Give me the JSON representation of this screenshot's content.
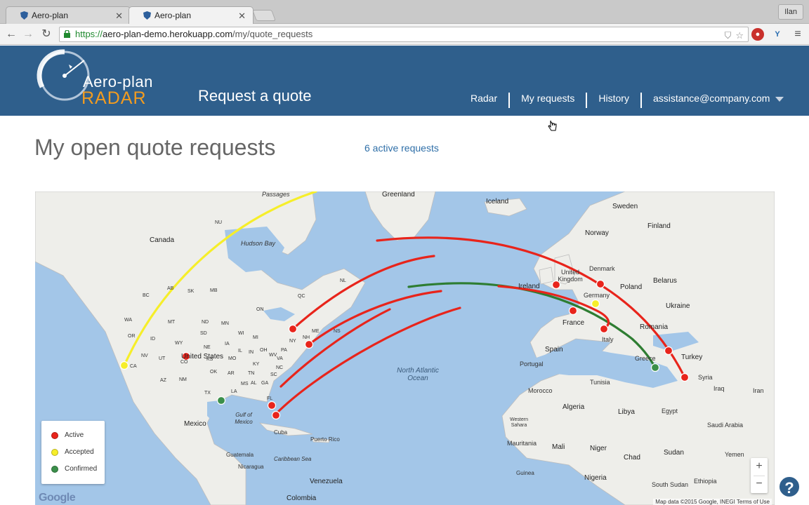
{
  "browser": {
    "tabs": [
      {
        "title": "Aero-plan",
        "active": false
      },
      {
        "title": "Aero-plan",
        "active": true
      }
    ],
    "user": "Ilan",
    "url": {
      "scheme": "https://",
      "host": "aero-plan-demo.herokuapp.com",
      "path": "/my/quote_requests"
    }
  },
  "header": {
    "logo_line1": "Aero-plan",
    "logo_line2": "RADAR",
    "page_title": "Request a quote",
    "nav": [
      {
        "label": "Radar"
      },
      {
        "label": "My requests"
      },
      {
        "label": "History"
      },
      {
        "label": "assistance@company.com"
      }
    ]
  },
  "main": {
    "title": "My open quote requests",
    "active_count": "6 active requests"
  },
  "map": {
    "labels": {
      "passages": "Passages",
      "greenland": "Greenland",
      "iceland": "Iceland",
      "sweden": "Sweden",
      "finland": "Finland",
      "norway": "Norway",
      "canada": "Canada",
      "hudson_bay": "Hudson Bay",
      "uk": "United Kingdom",
      "ireland": "Ireland",
      "denmark": "Denmark",
      "belarus": "Belarus",
      "poland": "Poland",
      "germany": "Germany",
      "ukraine": "Ukraine",
      "france": "France",
      "romania": "Romania",
      "italy": "Italy",
      "spain": "Spain",
      "portugal": "Portugal",
      "greece": "Greece",
      "turkey": "Turkey",
      "syria": "Syria",
      "iraq": "Iraq",
      "iran": "Iran",
      "tunisia": "Tunisia",
      "morocco": "Morocco",
      "algeria": "Algeria",
      "libya": "Libya",
      "egypt": "Egypt",
      "saudi": "Saudi Arabia",
      "western_sahara": "Western Sahara",
      "mauritania": "Mauritania",
      "mali": "Mali",
      "niger": "Niger",
      "chad": "Chad",
      "sudan": "Sudan",
      "south_sudan": "South Sudan",
      "ethiopia": "Ethiopia",
      "yemen": "Yemen",
      "nigeria": "Nigeria",
      "guinea": "Guinea",
      "united_states": "United States",
      "mexico": "Mexico",
      "gulf_of_mexico": "Gulf of Mexico",
      "cuba": "Cuba",
      "puerto_rico": "Puerto Rico",
      "guatemala": "Guatemala",
      "nicaragua": "Nicaragua",
      "caribbean": "Caribbean Sea",
      "venezuela": "Venezuela",
      "colombia": "Colombia",
      "north_atlantic": "North Atlantic Ocean",
      "ca": "CA",
      "nv": "NV",
      "or": "OR",
      "wa": "WA",
      "id": "ID",
      "mt": "MT",
      "wy": "WY",
      "ut": "UT",
      "az": "AZ",
      "co": "CO",
      "nm": "NM",
      "nd": "ND",
      "sd": "SD",
      "ne": "NE",
      "ks": "KS",
      "ok": "OK",
      "tx": "TX",
      "mn": "MN",
      "ia": "IA",
      "mo": "MO",
      "ar": "AR",
      "la": "LA",
      "wi": "WI",
      "il": "IL",
      "mi": "MI",
      "in": "IN",
      "oh": "OH",
      "ky": "KY",
      "tn": "TN",
      "ms": "MS",
      "al": "AL",
      "ga": "GA",
      "fl": "FL",
      "sc": "SC",
      "nc": "NC",
      "va": "VA",
      "wv": "WV",
      "pa": "PA",
      "ny": "NY",
      "me": "ME",
      "nh": "NH",
      "ns": "NS",
      "qc": "QC",
      "on": "ON",
      "mb": "MB",
      "sk": "SK",
      "ab": "AB",
      "bc": "BC",
      "nl": "NL",
      "nu": "NU"
    },
    "legend": [
      {
        "label": "Active",
        "color": "#e8241b"
      },
      {
        "label": "Accepted",
        "color": "#f6ee2a"
      },
      {
        "label": "Confirmed",
        "color": "#3b8f4a"
      }
    ],
    "zoom_in": "+",
    "zoom_out": "−",
    "google": "Google",
    "attribution": "Map data ©2015 Google, INEGI  Terms of Use"
  },
  "help": "?"
}
